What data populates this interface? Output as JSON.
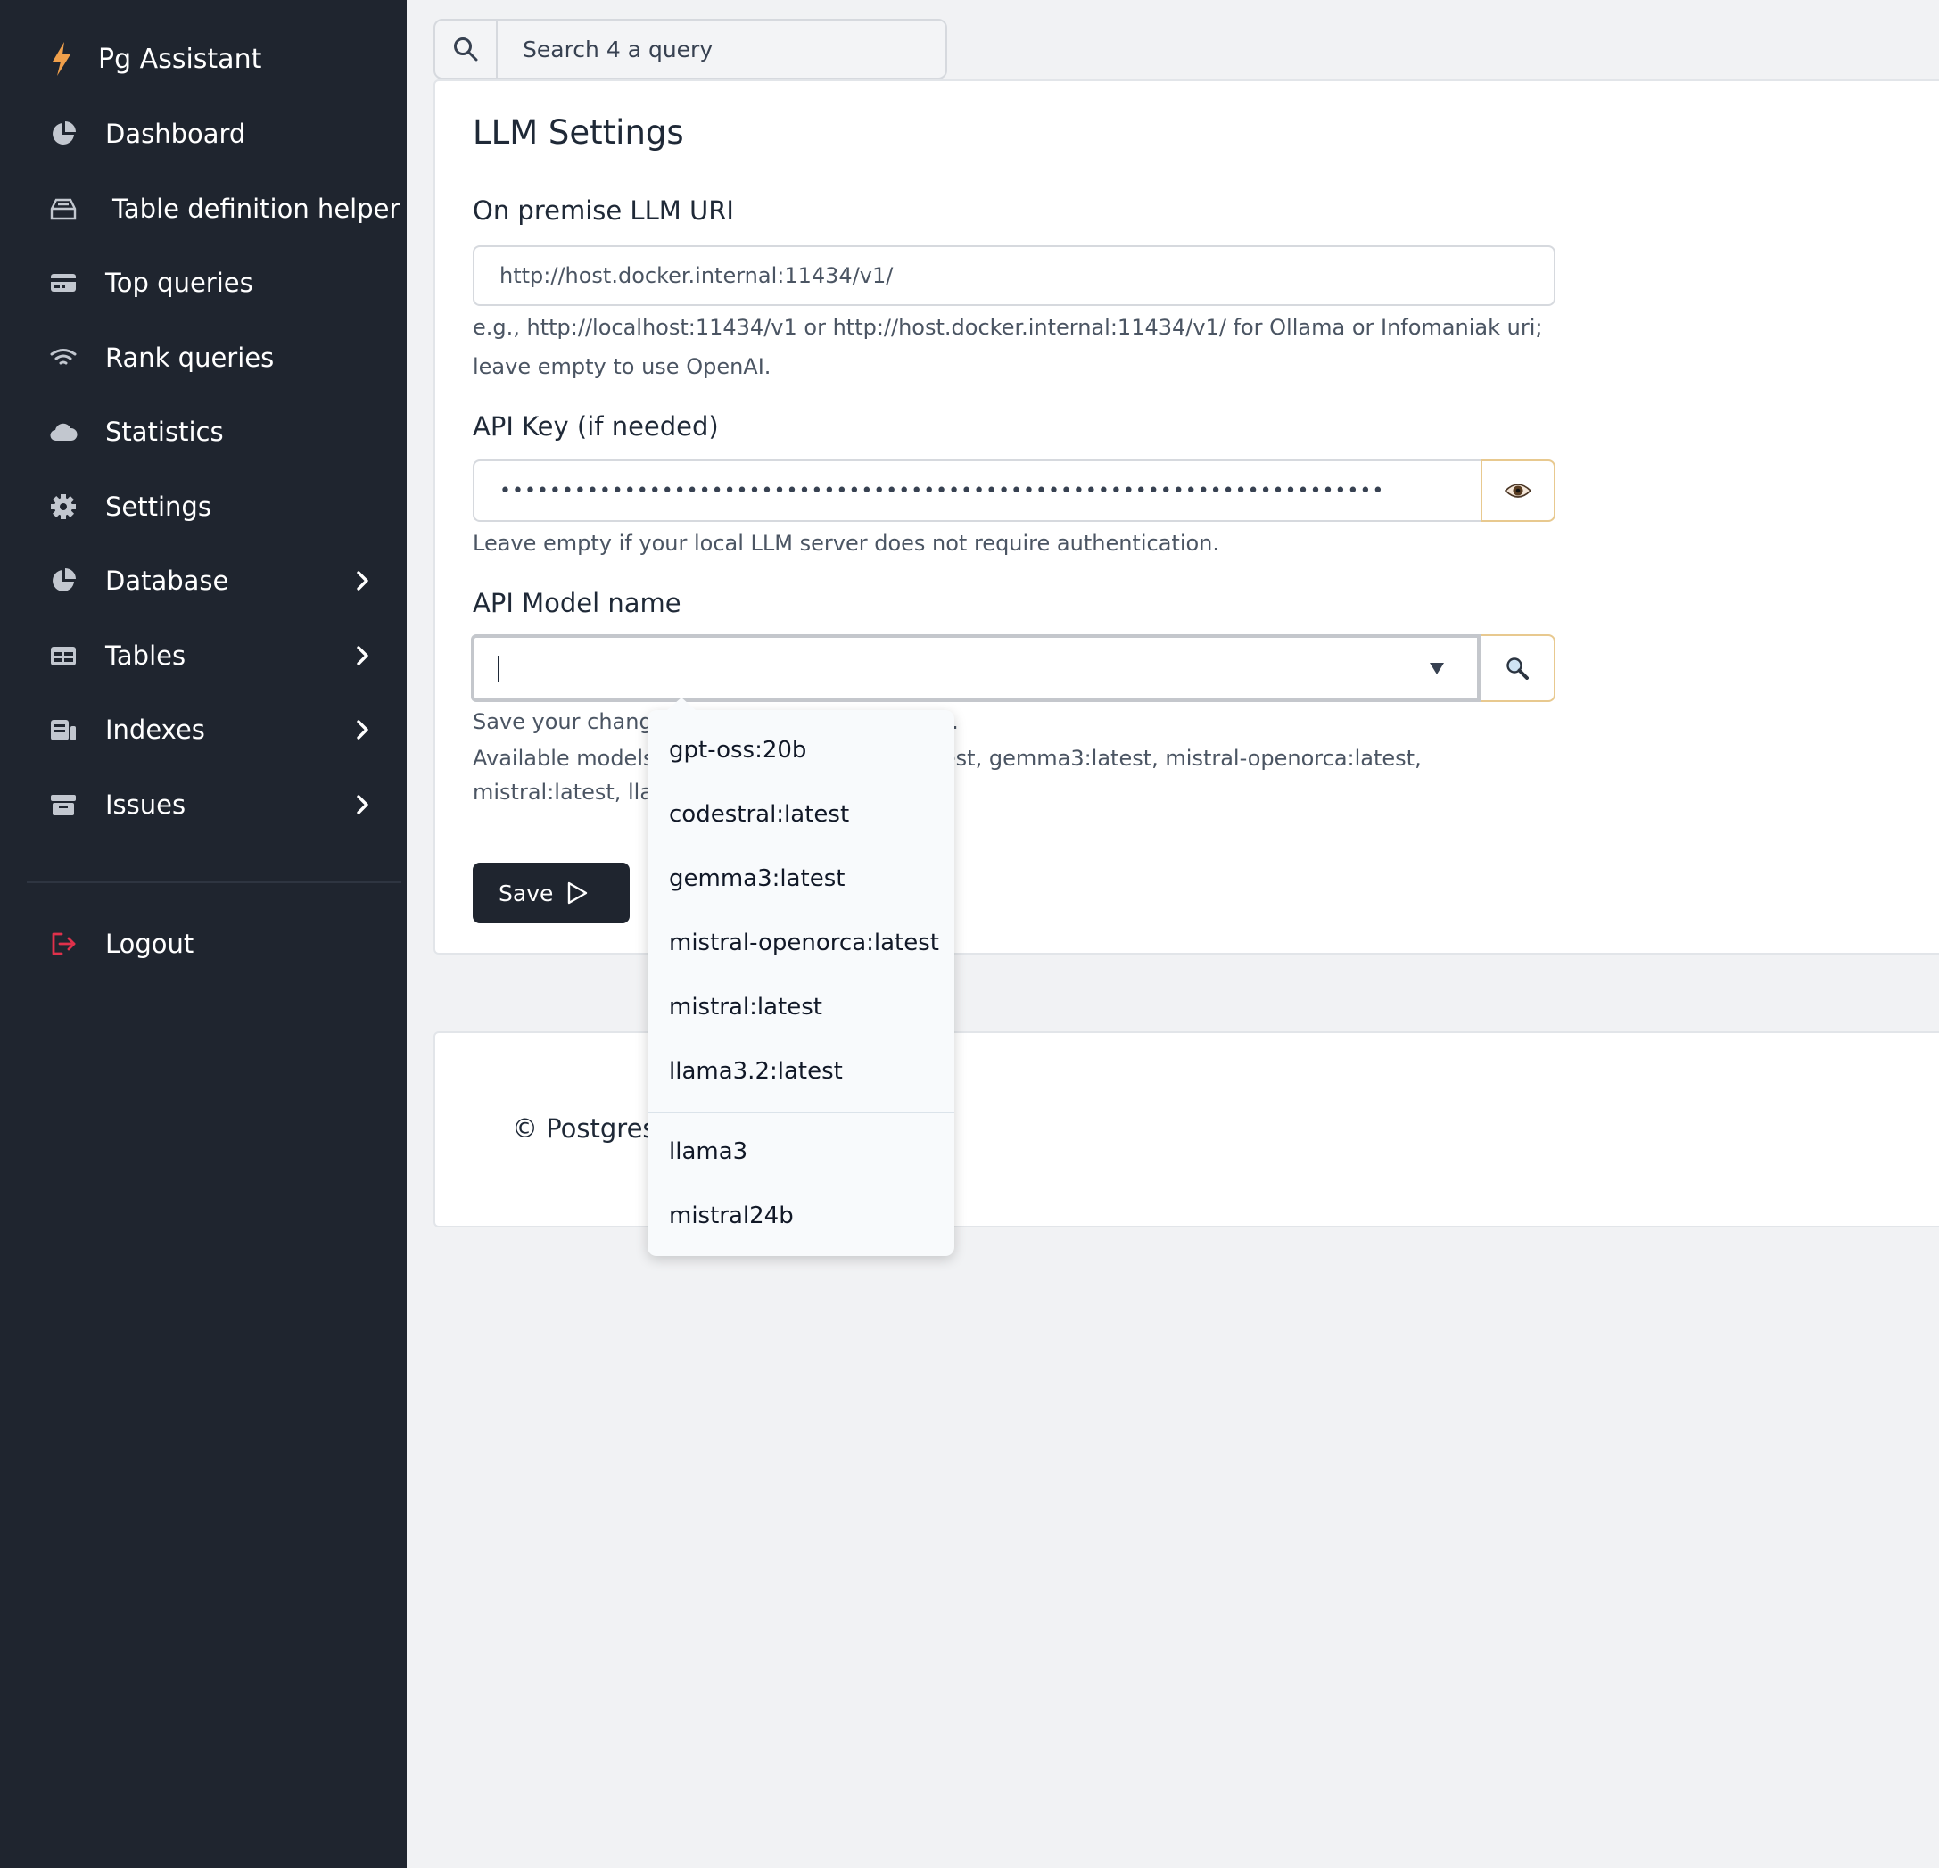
{
  "colors": {
    "sidebar_bg": "#1f252f",
    "page_bg": "#f1f2f4",
    "brand_accent": "#f0a04b",
    "logout_accent": "#e0314b",
    "icon_gray": "#c2c7cf"
  },
  "sidebar": {
    "brand": {
      "icon": "bolt-icon",
      "label": "Pg Assistant"
    },
    "items": [
      {
        "label": "Dashboard",
        "icon": "pie-chart-icon"
      },
      {
        "label": "Table definition helper",
        "icon": "tray-icon"
      },
      {
        "label": "Top queries",
        "icon": "card-icon"
      },
      {
        "label": "Rank queries",
        "icon": "wifi-icon"
      },
      {
        "label": "Statistics",
        "icon": "cloud-icon"
      },
      {
        "label": "Settings",
        "icon": "gear-icon"
      },
      {
        "label": "Database",
        "icon": "pie-chart-icon",
        "submenu": true
      },
      {
        "label": "Tables",
        "icon": "table-icon",
        "submenu": true
      },
      {
        "label": "Indexes",
        "icon": "index-icon",
        "submenu": true
      },
      {
        "label": "Issues",
        "icon": "archive-icon",
        "submenu": true
      }
    ],
    "logout": {
      "label": "Logout",
      "icon": "logout-icon"
    }
  },
  "search": {
    "icon": "search-icon",
    "placeholder": "Search 4 a query"
  },
  "settings": {
    "title": "LLM Settings",
    "uri": {
      "label": "On premise LLM URI",
      "value": "http://host.docker.internal:11434/v1/",
      "help_line1": "e.g., http://localhost:11434/v1 or http://host.docker.internal:11434/v1/ for Ollama or Infomaniak uri;",
      "help_line2": "leave empty to use OpenAI."
    },
    "api_key": {
      "label": "API Key (if needed)",
      "value": "•••••••••••••••••••••••••••••••••••••••••••••••••••••••••••••••••••••••",
      "toggle_icon": "eye-icon",
      "help": "Leave empty if your local LLM server does not require authentication."
    },
    "model": {
      "label": "API Model name",
      "value": "",
      "fetch_icon": "magnifier-icon",
      "help_save": "Save your changes first to see the model list.",
      "help_available": "Available models: gpt-oss:20b, codestral:latest, gemma3:latest, mistral-openorca:latest, mistral:latest, llama3.2:latest"
    },
    "save_label": "Save",
    "save_icon": "play-icon"
  },
  "dropdown": {
    "options": [
      "gpt-oss:20b",
      "codestral:latest",
      "gemma3:latest",
      "mistral-openorca:latest",
      "mistral:latest",
      "llama3.2:latest"
    ],
    "extra_options": [
      "llama3",
      "mistral24b"
    ]
  },
  "footer": {
    "text": "© Postgres"
  }
}
